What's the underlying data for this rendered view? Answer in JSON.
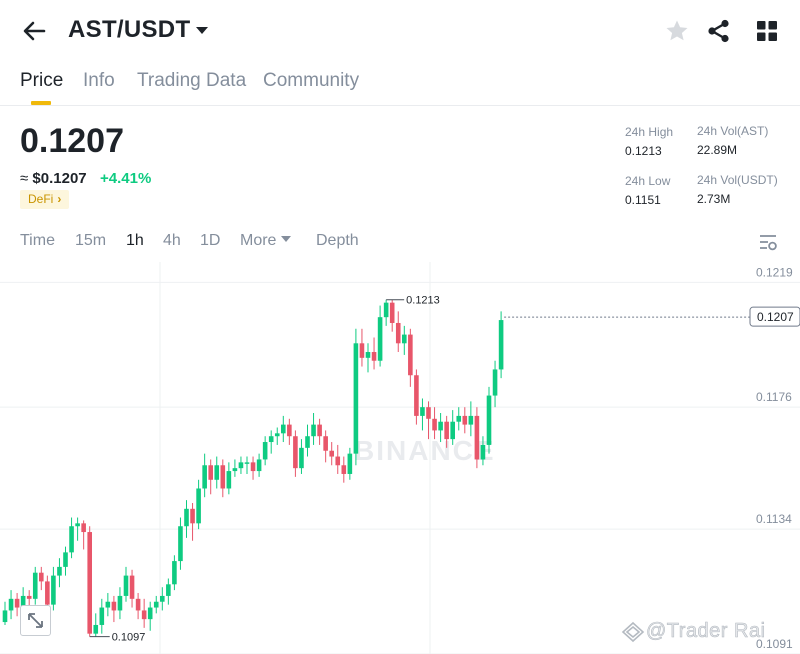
{
  "header": {
    "pair": "AST/USDT",
    "icons": {
      "back": "arrow-left-icon",
      "caret": "caret-down-icon",
      "favorite": "star-icon",
      "share": "share-icon",
      "grid": "grid-icon"
    }
  },
  "tabs": [
    {
      "label": "Price",
      "active": true
    },
    {
      "label": "Info",
      "active": false
    },
    {
      "label": "Trading Data",
      "active": false
    },
    {
      "label": "Community",
      "active": false
    }
  ],
  "ticker": {
    "last_price": "0.1207",
    "approx_prefix": "≈",
    "approx_fiat": "$0.1207",
    "change": "+4.41%",
    "tag": "DeFi",
    "tag_chevron": "›"
  },
  "stats": {
    "high_label": "24h High",
    "high_value": "0.1213",
    "vol_base_label": "24h Vol(AST)",
    "vol_base_value": "22.89M",
    "low_label": "24h Low",
    "low_value": "0.1151",
    "vol_quote_label": "24h Vol(USDT)",
    "vol_quote_value": "2.73M"
  },
  "intervals": {
    "time": "Time",
    "m15": "15m",
    "h1": "1h",
    "h4": "4h",
    "d1": "1D",
    "more": "More",
    "depth": "Depth",
    "active": "1h"
  },
  "watermark": {
    "chart": "BINANCE",
    "overlay": "@Trader Rai"
  },
  "colors": {
    "up": "#0ecb81",
    "down": "#e8566a",
    "accent": "#f0b90b",
    "muted": "#848e9c",
    "grid": "#eef0f2"
  },
  "chart_data": {
    "type": "candlestick",
    "interval": "1h",
    "y_ticks": [
      0.1219,
      0.1176,
      0.1134,
      0.1091
    ],
    "ylim": [
      0.1091,
      0.1226
    ],
    "last_price_label": "0.1207",
    "max_label": "0.1213",
    "min_label": "0.1097",
    "grid": true,
    "candles": [
      [
        0.1102,
        0.1106,
        0.1101,
        0.1109
      ],
      [
        0.1106,
        0.111,
        0.1103,
        0.1113
      ],
      [
        0.111,
        0.1107,
        0.1104,
        0.1112
      ],
      [
        0.1107,
        0.1111,
        0.1103,
        0.1114
      ],
      [
        0.1111,
        0.111,
        0.1106,
        0.1113
      ],
      [
        0.111,
        0.1119,
        0.1108,
        0.1121
      ],
      [
        0.1119,
        0.1116,
        0.1113,
        0.1121
      ],
      [
        0.1116,
        0.1108,
        0.1105,
        0.1118
      ],
      [
        0.1108,
        0.1118,
        0.1106,
        0.1121
      ],
      [
        0.1118,
        0.1121,
        0.1114,
        0.1124
      ],
      [
        0.1121,
        0.1126,
        0.1118,
        0.1128
      ],
      [
        0.1126,
        0.1135,
        0.1124,
        0.1138
      ],
      [
        0.1135,
        0.1136,
        0.113,
        0.1138
      ],
      [
        0.1136,
        0.1133,
        0.1127,
        0.1137
      ],
      [
        0.1133,
        0.1098,
        0.1097,
        0.1135
      ],
      [
        0.1098,
        0.1101,
        0.1097,
        0.1105
      ],
      [
        0.1101,
        0.1107,
        0.1098,
        0.111
      ],
      [
        0.1107,
        0.1109,
        0.1104,
        0.1112
      ],
      [
        0.1109,
        0.1106,
        0.1102,
        0.1111
      ],
      [
        0.1106,
        0.1111,
        0.1103,
        0.1114
      ],
      [
        0.1111,
        0.1118,
        0.1109,
        0.1121
      ],
      [
        0.1118,
        0.111,
        0.1107,
        0.112
      ],
      [
        0.111,
        0.1106,
        0.1103,
        0.1112
      ],
      [
        0.1106,
        0.1103,
        0.11,
        0.111
      ],
      [
        0.1103,
        0.1107,
        0.1099,
        0.1109
      ],
      [
        0.1107,
        0.1109,
        0.1105,
        0.1111
      ],
      [
        0.1109,
        0.1111,
        0.1106,
        0.1114
      ],
      [
        0.1111,
        0.1115,
        0.1108,
        0.1117
      ],
      [
        0.1115,
        0.1123,
        0.1113,
        0.1125
      ],
      [
        0.1123,
        0.1135,
        0.112,
        0.1138
      ],
      [
        0.1135,
        0.1141,
        0.1131,
        0.1144
      ],
      [
        0.1141,
        0.1136,
        0.113,
        0.1143
      ],
      [
        0.1136,
        0.1148,
        0.1134,
        0.1151
      ],
      [
        0.1148,
        0.1156,
        0.1145,
        0.116
      ],
      [
        0.1156,
        0.1151,
        0.1146,
        0.1158
      ],
      [
        0.1151,
        0.1156,
        0.1148,
        0.1159
      ],
      [
        0.1156,
        0.1148,
        0.1145,
        0.1158
      ],
      [
        0.1148,
        0.1154,
        0.1146,
        0.1157
      ],
      [
        0.1154,
        0.1155,
        0.1152,
        0.1158
      ],
      [
        0.1155,
        0.1157,
        0.1153,
        0.1159
      ],
      [
        0.1157,
        0.1157,
        0.1153,
        0.1159
      ],
      [
        0.1157,
        0.1154,
        0.1151,
        0.1159
      ],
      [
        0.1154,
        0.1158,
        0.1152,
        0.116
      ],
      [
        0.1158,
        0.1164,
        0.1156,
        0.1166
      ],
      [
        0.1164,
        0.1166,
        0.116,
        0.1168
      ],
      [
        0.1166,
        0.1167,
        0.1163,
        0.1169
      ],
      [
        0.1167,
        0.117,
        0.1164,
        0.1173
      ],
      [
        0.117,
        0.1166,
        0.1163,
        0.1172
      ],
      [
        0.1166,
        0.1155,
        0.1152,
        0.1168
      ],
      [
        0.1155,
        0.1162,
        0.1153,
        0.1165
      ],
      [
        0.1162,
        0.1166,
        0.1159,
        0.117
      ],
      [
        0.1166,
        0.117,
        0.1163,
        0.1174
      ],
      [
        0.117,
        0.1166,
        0.1163,
        0.1172
      ],
      [
        0.1166,
        0.1161,
        0.1157,
        0.1168
      ],
      [
        0.1161,
        0.1159,
        0.1156,
        0.1164
      ],
      [
        0.1159,
        0.1156,
        0.1153,
        0.1163
      ],
      [
        0.1156,
        0.1153,
        0.115,
        0.1159
      ],
      [
        0.1153,
        0.116,
        0.1151,
        0.1162
      ],
      [
        0.116,
        0.1198,
        0.1156,
        0.1203
      ],
      [
        0.1198,
        0.1193,
        0.119,
        0.1203
      ],
      [
        0.1193,
        0.1195,
        0.1188,
        0.1198
      ],
      [
        0.1195,
        0.1192,
        0.1189,
        0.12
      ],
      [
        0.1192,
        0.1207,
        0.119,
        0.1211
      ],
      [
        0.1207,
        0.1212,
        0.1204,
        0.1213
      ],
      [
        0.1212,
        0.1205,
        0.1202,
        0.1213
      ],
      [
        0.1205,
        0.1198,
        0.1195,
        0.1209
      ],
      [
        0.1198,
        0.1201,
        0.1194,
        0.1204
      ],
      [
        0.1201,
        0.1187,
        0.1183,
        0.1203
      ],
      [
        0.1187,
        0.1173,
        0.117,
        0.1189
      ],
      [
        0.1173,
        0.1176,
        0.1168,
        0.1179
      ],
      [
        0.1176,
        0.1172,
        0.1165,
        0.1178
      ],
      [
        0.1172,
        0.1168,
        0.1165,
        0.1176
      ],
      [
        0.1168,
        0.1171,
        0.1164,
        0.1174
      ],
      [
        0.1171,
        0.1165,
        0.1162,
        0.1173
      ],
      [
        0.1165,
        0.1171,
        0.1163,
        0.1175
      ],
      [
        0.1171,
        0.1173,
        0.1168,
        0.1176
      ],
      [
        0.1173,
        0.117,
        0.1167,
        0.1176
      ],
      [
        0.117,
        0.1173,
        0.1166,
        0.1178
      ],
      [
        0.1173,
        0.1158,
        0.1155,
        0.1176
      ],
      [
        0.1158,
        0.1163,
        0.1156,
        0.1166
      ],
      [
        0.1163,
        0.118,
        0.116,
        0.1183
      ],
      [
        0.118,
        0.1189,
        0.1176,
        0.1192
      ],
      [
        0.1189,
        0.1206,
        0.1186,
        0.1209
      ]
    ]
  }
}
